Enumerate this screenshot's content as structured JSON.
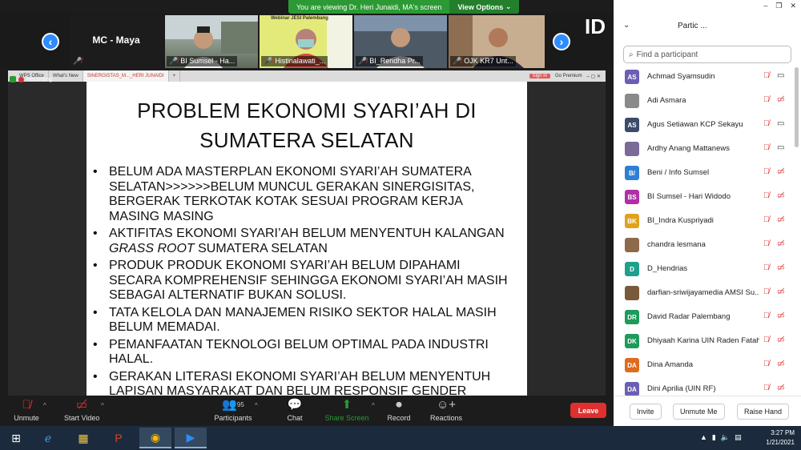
{
  "banner": {
    "viewing_text": "You are viewing Dr. Heri Junaidi, MA's screen",
    "view_options_label": "View Options"
  },
  "thumbnails": {
    "mc_name": "MC - Maya",
    "tiles": [
      {
        "name": "BI Sumsel - Ha..."
      },
      {
        "name": "Histinalawati_..."
      },
      {
        "name": "BI_Rendha Pr..."
      },
      {
        "name": "OJK KR7 Unt..."
      }
    ],
    "webinar_label": "Webinar JESI Palembang"
  },
  "browser": {
    "tabs": [
      "WPS Office",
      "What's New",
      "SINERGISTAS_M..._HERI JUNAIDI"
    ],
    "sign_in": "Sign in",
    "go_premium": "Go Premium",
    "recording": "Recording"
  },
  "slide": {
    "title_line1": "PROBLEM EKONOMI SYARI’AH DI",
    "title_line2": "SUMATERA SELATAN",
    "bullets": [
      {
        "text": "BELUM ADA MASTERPLAN EKONOMI SYARI’AH SUMATERA SELATAN>>>>>>BELUM MUNCUL GERAKAN SINERGISITAS, BERGERAK TERKOTAK KOTAK  SESUAI PROGRAM KERJA MASING MASING"
      },
      {
        "text_before": "AKTIFITAS EKONOMI SYARI’AH BELUM MENYENTUH KALANGAN ",
        "italic": "GRASS ROOT",
        "text_after": " SUMATERA SELATAN"
      },
      {
        "text": "PRODUK PRODUK EKONOMI SYARI’AH BELUM DIPAHAMI SECARA KOMPREHENSIF SEHINGGA EKONOMI SYARI’AH MASIH SEBAGAI ALTERNATIF BUKAN SOLUSI."
      },
      {
        "text": "TATA KELOLA DAN MANAJEMEN RISIKO SEKTOR HALAL MASIH BELUM MEMADAI."
      },
      {
        "text": "PEMANFAATAN TEKNOLOGI BELUM OPTIMAL PADA INDUSTRI HALAL."
      },
      {
        "text": "GERAKAN LITERASI EKONOMI SYARI’AH BELUM MENYENTUH LAPISAN MASYARAKAT DAN BELUM RESPONSIF GENDER"
      }
    ]
  },
  "toolbar": {
    "unmute": "Unmute",
    "start_video": "Start Video",
    "participants": "Participants",
    "participants_count": "95",
    "chat": "Chat",
    "share_screen": "Share Screen",
    "record": "Record",
    "reactions": "Reactions",
    "leave": "Leave"
  },
  "panel": {
    "title": "Partic  ...",
    "search_placeholder": "Find a participant",
    "participants": [
      {
        "initials": "AS",
        "name": "Achmad Syamsudin",
        "color": "#6b5fb5",
        "cam_on": true
      },
      {
        "initials": "",
        "name": "Adi Asmara",
        "color": "#8a8a8a",
        "cam_on": false
      },
      {
        "initials": "AS",
        "name": "Agus Setiawan KCP Sekayu",
        "color": "#3c4a6b",
        "cam_on": true
      },
      {
        "initials": "",
        "name": "Ardhy Anang Mattanews",
        "color": "#7a6a9a",
        "cam_on": true
      },
      {
        "initials": "B/",
        "name": "Beni / Info Sumsel",
        "color": "#2f7fd4",
        "cam_on": false
      },
      {
        "initials": "BS",
        "name": "BI Sumsel - Hari Widodo",
        "color": "#b02fa8",
        "cam_on": false
      },
      {
        "initials": "BK",
        "name": "BI_Indra Kuspriyadi",
        "color": "#e0a21e",
        "cam_on": false
      },
      {
        "initials": "",
        "name": "chandra lesmana",
        "color": "#8c6a4a",
        "cam_on": false
      },
      {
        "initials": "D",
        "name": "D_Hendrias",
        "color": "#1ea08c",
        "cam_on": false
      },
      {
        "initials": "",
        "name": "darfian-sriwijayamedia AMSI Su...",
        "color": "#7a5a3a",
        "cam_on": false
      },
      {
        "initials": "DR",
        "name": "David Radar Palembang",
        "color": "#1e9a5a",
        "cam_on": false
      },
      {
        "initials": "DK",
        "name": "Dhiyaah Karina UIN Raden Fatah",
        "color": "#1e9a5a",
        "cam_on": false
      },
      {
        "initials": "DA",
        "name": "Dina Amanda",
        "color": "#e06a1e",
        "cam_on": false
      },
      {
        "initials": "DA",
        "name": "Dini Aprilia (UIN RF)",
        "color": "#6b5fb5",
        "cam_on": false
      }
    ],
    "invite": "Invite",
    "unmute_me": "Unmute Me",
    "raise_hand": "Raise Hand"
  },
  "taskbar": {
    "time": "3:27 PM",
    "date": "1/21/2021"
  }
}
